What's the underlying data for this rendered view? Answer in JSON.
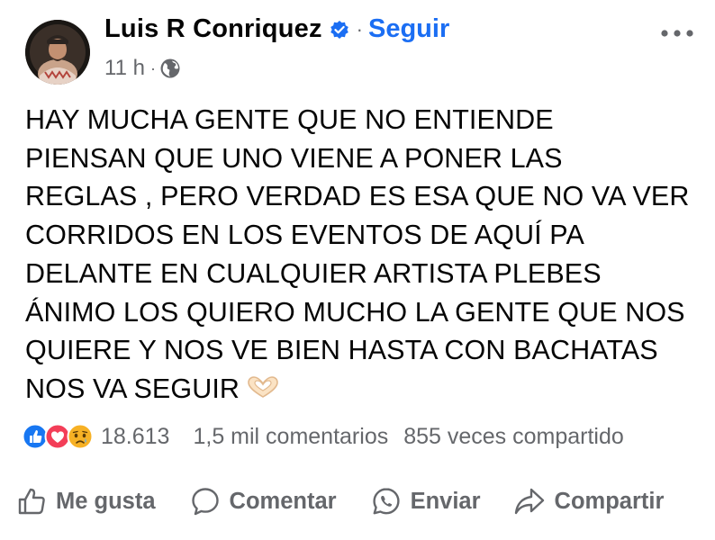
{
  "post": {
    "author": {
      "name": "Luis R Conriquez",
      "verified_icon": "verified-badge-icon",
      "follow_label": "Seguir",
      "separator": "·"
    },
    "meta": {
      "time": "11 h",
      "separator": "·",
      "audience_icon": "globe-icon"
    },
    "more_icon": "more-horizontal-icon",
    "text_lines": [
      "HAY MUCHA GENTE QUE NO ENTIENDE",
      "PIENSAN QUE UNO VIENE A PONER LAS",
      "REGLAS , PERO VERDAD ES ESA QUE NO VA VER",
      "CORRIDOS EN LOS EVENTOS DE AQUÍ PA",
      "DELANTE EN CUALQUIER ARTISTA PLEBES",
      "ÁNIMO LOS QUIERO MUCHO LA GENTE QUE NOS",
      "QUIERE Y NOS VE BIEN HASTA CON BACHATAS",
      "NOS VA SEGUIR"
    ],
    "text_emoji": "heart-hands-icon"
  },
  "stats": {
    "reactions": [
      "like-reaction-icon",
      "love-reaction-icon",
      "sad-reaction-icon"
    ],
    "reaction_count": "18.613",
    "comments": "1,5 mil comentarios",
    "shares": "855 veces compartido"
  },
  "actions": {
    "like_label": "Me gusta",
    "comment_label": "Comentar",
    "send_label": "Enviar",
    "share_label": "Compartir"
  },
  "colors": {
    "accent": "#1b6ef3",
    "secondary_text": "#65676b",
    "primary_text": "#050505",
    "like": "#1877f2",
    "love": "#f33e58",
    "sad": "#f7b125"
  }
}
